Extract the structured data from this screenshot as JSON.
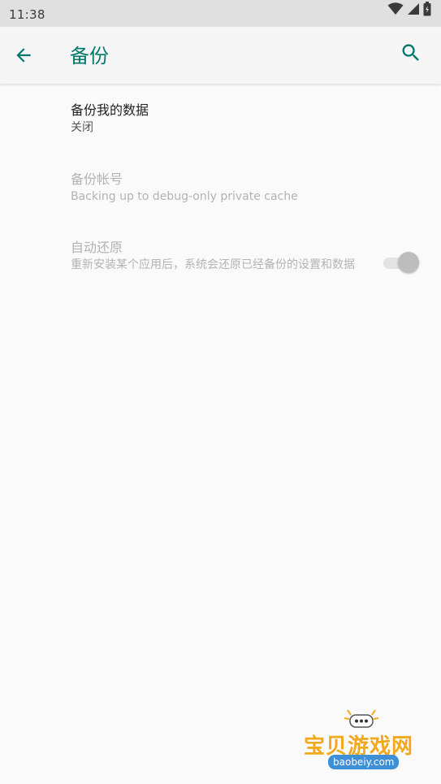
{
  "status_bar": {
    "time": "11:38",
    "icons": [
      "wifi-icon",
      "cell-signal-icon",
      "battery-icon"
    ]
  },
  "app_bar": {
    "back_icon": "arrow-back-icon",
    "title": "备份",
    "search_icon": "search-icon",
    "accent_color": "#00796b"
  },
  "preferences": {
    "backup_my_data": {
      "title": "备份我的数据",
      "summary": "关闭",
      "enabled": true
    },
    "backup_account": {
      "title": "备份帐号",
      "summary": "Backing up to debug-only private cache",
      "enabled": false
    },
    "auto_restore": {
      "title": "自动还原",
      "summary": "重新安装某个应用后，系统会还原已经备份的设置和数据",
      "enabled": false,
      "switch_on": true
    }
  },
  "watermark": {
    "text": "宝贝游戏网",
    "url": "baobeiy.com"
  }
}
